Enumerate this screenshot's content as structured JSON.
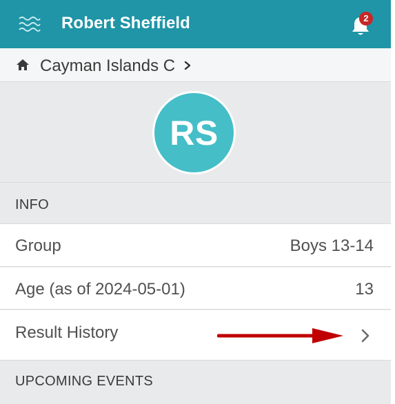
{
  "header": {
    "title": "Robert Sheffield",
    "notification_count": "2",
    "accent_color": "#1f95a7",
    "badge_color": "#c62828",
    "menu_icon": "waves-menu-icon",
    "bell_icon": "bell-icon"
  },
  "breadcrumb": {
    "label": "Cayman Islands C",
    "home_icon": "home-icon",
    "chevron_icon": "chevron-right-icon"
  },
  "profile": {
    "initials": "RS",
    "avatar_color": "#45bec8"
  },
  "info_section": {
    "header": "INFO",
    "rows": [
      {
        "label": "Group",
        "value": "Boys 13-14"
      },
      {
        "label": "Age (as of 2024-05-01)",
        "value": "13"
      }
    ],
    "result_history_label": "Result History"
  },
  "upcoming_section": {
    "header": "UPCOMING EVENTS"
  },
  "annotation": {
    "arrow_color": "#c00000"
  }
}
